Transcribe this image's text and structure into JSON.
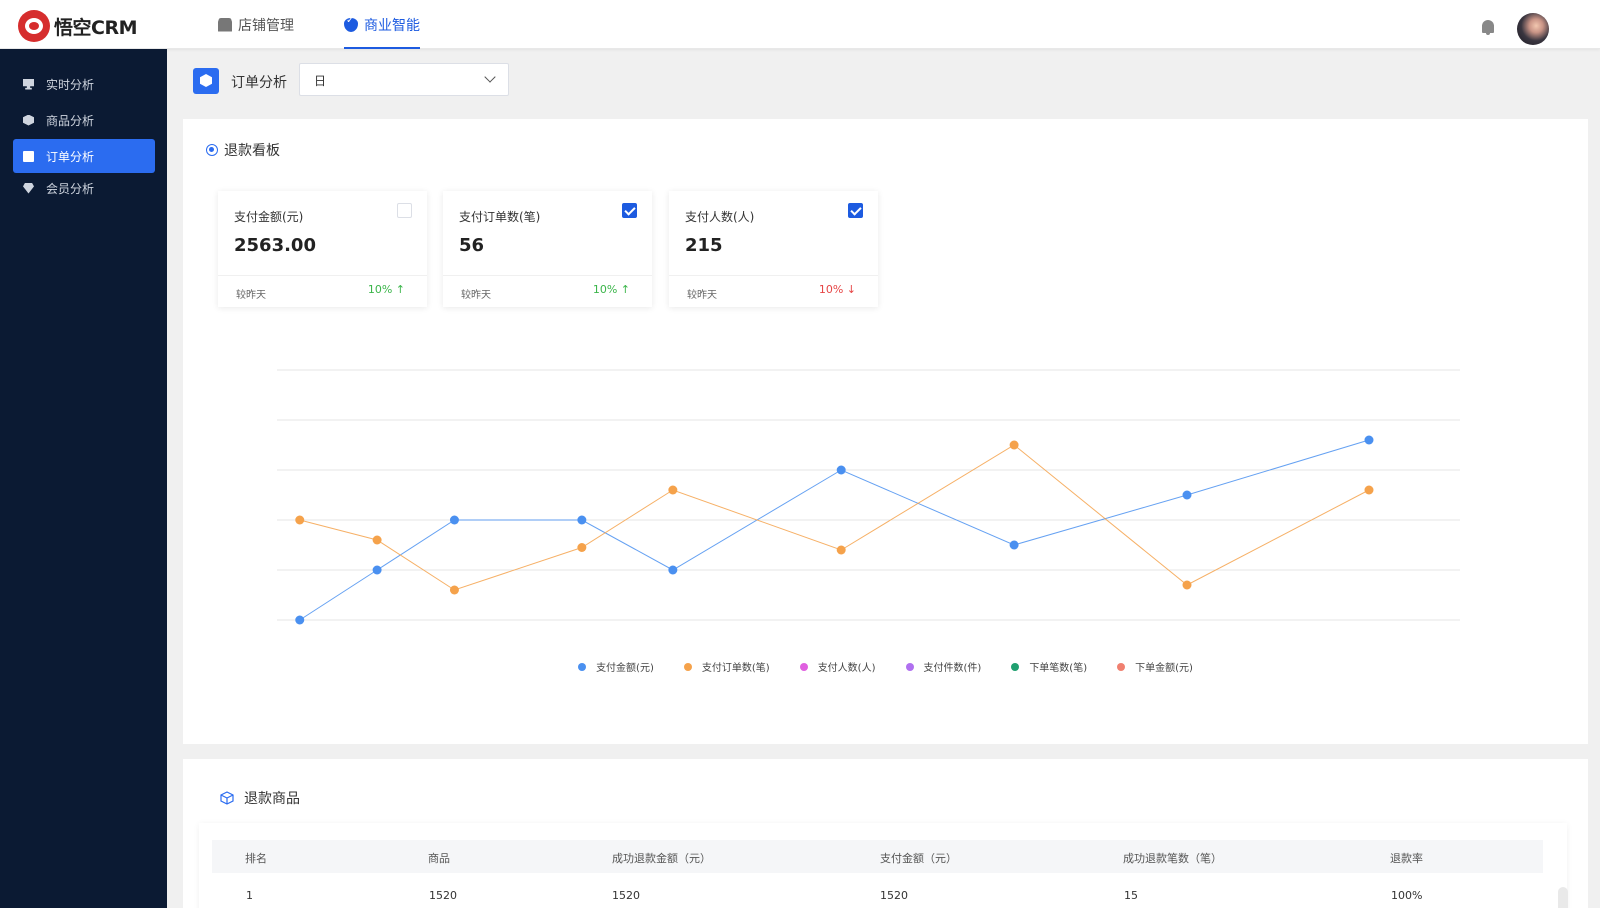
{
  "app": {
    "logo_text": "悟空CRM"
  },
  "topnav": {
    "items": [
      {
        "label": "店铺管理",
        "icon": "store-icon",
        "active": false
      },
      {
        "label": "商业智能",
        "icon": "bi-shield-icon",
        "active": true
      }
    ]
  },
  "sidebar": {
    "items": [
      {
        "label": "实时分析",
        "icon": "monitor-icon",
        "active": false
      },
      {
        "label": "商品分析",
        "icon": "cube-icon",
        "active": false
      },
      {
        "label": "订单分析",
        "icon": "document-icon",
        "active": true
      },
      {
        "label": "会员分析",
        "icon": "gem-icon",
        "active": false
      }
    ]
  },
  "page": {
    "title": "订单分析",
    "period_select": "日"
  },
  "refund_board": {
    "title": "退款看板",
    "metrics": [
      {
        "label": "支付金额(元)",
        "value": "2563.00",
        "compare_label": "较昨天",
        "change": "10%",
        "arrow": "↑",
        "direction": "up",
        "checked": false
      },
      {
        "label": "支付订单数(笔)",
        "value": "56",
        "compare_label": "较昨天",
        "change": "10%",
        "arrow": "↑",
        "direction": "up",
        "checked": true
      },
      {
        "label": "支付人数(人)",
        "value": "215",
        "compare_label": "较昨天",
        "change": "10%",
        "arrow": "↓",
        "direction": "down",
        "checked": true
      }
    ]
  },
  "chart_data": {
    "type": "line",
    "title": "",
    "xlabel": "",
    "ylabel": "",
    "x": [
      1,
      2,
      3,
      4,
      5,
      6,
      7,
      8,
      9
    ],
    "ylim": [
      0,
      5
    ],
    "grid": true,
    "legend_position": "bottom-center",
    "series": [
      {
        "name": "支付金额(元)",
        "color": "#4a90f0",
        "points": [
          [
            0.25,
            0.0
          ],
          [
            1.1,
            1.0
          ],
          [
            1.95,
            2.0
          ],
          [
            3.35,
            2.0
          ],
          [
            4.35,
            1.0
          ],
          [
            6.2,
            3.0
          ],
          [
            8.1,
            1.5
          ],
          [
            10.0,
            2.5
          ],
          [
            12.0,
            3.6
          ]
        ]
      },
      {
        "name": "支付订单数(笔)",
        "color": "#f5a24b",
        "points": [
          [
            0.25,
            2.0
          ],
          [
            1.1,
            1.6
          ],
          [
            1.95,
            0.6
          ],
          [
            3.35,
            1.45
          ],
          [
            4.35,
            2.6
          ],
          [
            6.2,
            1.4
          ],
          [
            8.1,
            3.5
          ],
          [
            10.0,
            0.7
          ],
          [
            12.0,
            2.6
          ]
        ]
      }
    ],
    "legend": [
      {
        "name": "支付金额(元)",
        "color": "#4a90f0"
      },
      {
        "name": "支付订单数(笔)",
        "color": "#f5a24b"
      },
      {
        "name": "支付人数(人)",
        "color": "#e060e0"
      },
      {
        "name": "支付件数(件)",
        "color": "#b070f0"
      },
      {
        "name": "下单笔数(笔)",
        "color": "#20a070"
      },
      {
        "name": "下单金额(元)",
        "color": "#f08070"
      }
    ]
  },
  "refund_products": {
    "title": "退款商品",
    "columns": [
      "排名",
      "商品",
      "成功退款金额（元）",
      "支付金额（元）",
      "成功退款笔数（笔）",
      "退款率"
    ],
    "rows": [
      [
        "1",
        "1520",
        "1520",
        "1520",
        "15",
        "100%"
      ]
    ]
  }
}
